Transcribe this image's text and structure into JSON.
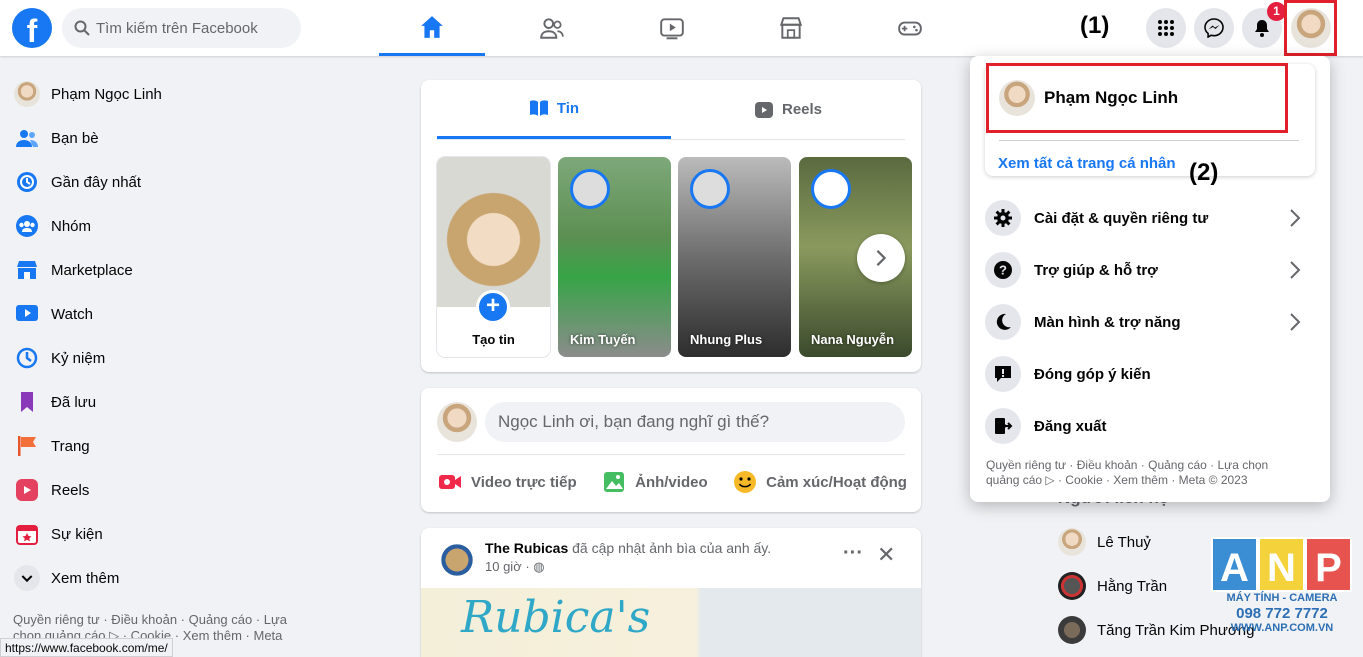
{
  "header": {
    "logo_letter": "f",
    "search_placeholder": "Tìm kiếm trên Facebook",
    "notification_count": "1",
    "annotation_1": "(1)",
    "annotation_2": "(2)"
  },
  "sidebar": {
    "items": [
      {
        "label": "Phạm Ngọc Linh",
        "icon": "avatar"
      },
      {
        "label": "Bạn bè",
        "icon": "friends-icon"
      },
      {
        "label": "Gần đây nhất",
        "icon": "recent-icon"
      },
      {
        "label": "Nhóm",
        "icon": "groups-icon"
      },
      {
        "label": "Marketplace",
        "icon": "marketplace-icon"
      },
      {
        "label": "Watch",
        "icon": "watch-icon"
      },
      {
        "label": "Kỷ niệm",
        "icon": "memories-icon"
      },
      {
        "label": "Đã lưu",
        "icon": "saved-icon"
      },
      {
        "label": "Trang",
        "icon": "pages-icon"
      },
      {
        "label": "Reels",
        "icon": "reels-icon"
      },
      {
        "label": "Sự kiện",
        "icon": "events-icon"
      },
      {
        "label": "Xem thêm",
        "icon": "chevron-down-icon"
      }
    ],
    "footer": "Quyền riêng tư · Điều khoản · Quảng cáo · Lựa chọn quảng cáo ▷ · Cookie · Xem thêm · Meta"
  },
  "status_url": "https://www.facebook.com/me/",
  "stories": {
    "tab_tin": "Tin",
    "tab_reels": "Reels",
    "create_label": "Tạo tin",
    "items": [
      {
        "name": "Kim Tuyến"
      },
      {
        "name": "Nhung Plus"
      },
      {
        "name": "Nana Nguyễn"
      }
    ]
  },
  "composer": {
    "placeholder": "Ngọc Linh ơi, bạn đang nghĩ gì thế?",
    "actions": [
      "Video trực tiếp",
      "Ảnh/video",
      "Cảm xúc/Hoạt động"
    ]
  },
  "post": {
    "author": "The Rubicas",
    "action_text": " đã cập nhật ảnh bìa của anh ấy.",
    "time": "10 giờ ·",
    "image_text": "Rubica's"
  },
  "menu": {
    "profile_name": "Phạm Ngọc Linh",
    "see_all_profiles": "Xem tất cả trang cá nhân",
    "items": [
      {
        "label": "Cài đặt & quyền riêng tư",
        "icon": "gear-icon",
        "has_chevron": true
      },
      {
        "label": "Trợ giúp & hỗ trợ",
        "icon": "help-icon",
        "has_chevron": true
      },
      {
        "label": "Màn hình & trợ năng",
        "icon": "moon-icon",
        "has_chevron": true
      },
      {
        "label": "Đóng góp ý kiến",
        "icon": "feedback-icon",
        "has_chevron": false
      },
      {
        "label": "Đăng xuất",
        "icon": "logout-icon",
        "has_chevron": false
      }
    ],
    "footer": "Quyền riêng tư · Điều khoản · Quảng cáo · Lựa chọn quảng cáo ▷ · Cookie · Xem thêm · Meta © 2023"
  },
  "contacts": {
    "heading": "Người liên hệ",
    "items": [
      {
        "name": "Lê Thuỷ"
      },
      {
        "name": "Hằng Trần"
      },
      {
        "name": "Tăng Trần Kim Phương"
      }
    ]
  },
  "watermark": {
    "letters": [
      "A",
      "N",
      "P"
    ],
    "tagline": "MÁY TÍNH - CAMERA",
    "phone": "098 772 7772",
    "site": "WWW.ANP.COM.VN"
  },
  "colors": {
    "brand_blue": "#1877f2",
    "highlight_red": "#e0202a",
    "background": "#f0f2f5"
  }
}
